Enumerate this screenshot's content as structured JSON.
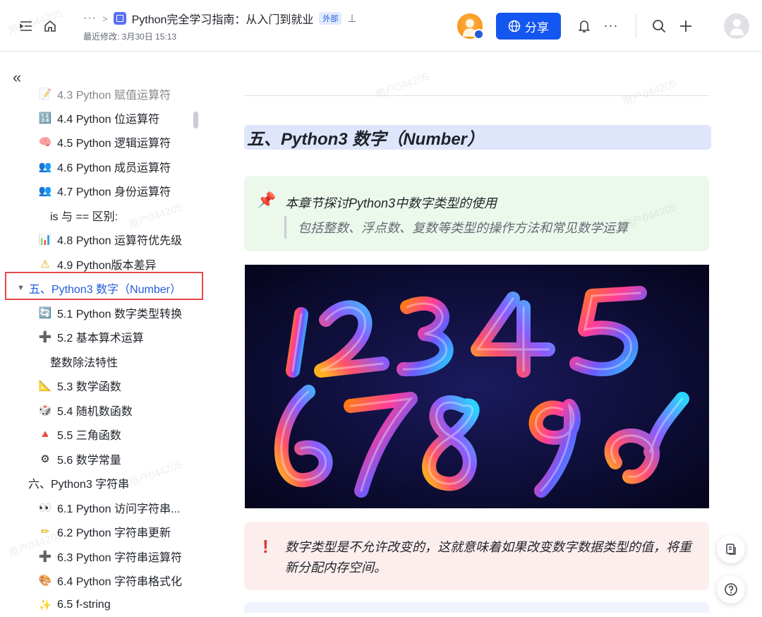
{
  "header": {
    "doc_title": "Python完全学习指南：从入门到就业",
    "external_badge": "外部",
    "last_modified": "最近修改: 3月30日 15:13",
    "more_label": "···",
    "share_label": "分享",
    "colors": {
      "share": "#1456f0",
      "accent": "#245bdb"
    }
  },
  "sidebar": {
    "items": [
      {
        "icon": "memo-icon",
        "glyph": "📝",
        "label": "4.3 Python 赋值运算符"
      },
      {
        "icon": "binary-icon",
        "glyph": "🔢",
        "label": "4.4 Python 位运算符"
      },
      {
        "icon": "brain-icon",
        "glyph": "🧠",
        "label": "4.5 Python 逻辑运算符"
      },
      {
        "icon": "people-icon",
        "glyph": "👥",
        "label": "4.6 Python 成员运算符"
      },
      {
        "icon": "people-icon",
        "glyph": "👥",
        "label": "4.7 Python 身份运算符"
      },
      {
        "icon": "",
        "glyph": "",
        "label": "is 与 == 区别:"
      },
      {
        "icon": "bar-chart-icon",
        "glyph": "📊",
        "label": "4.8 Python 运算符优先级"
      },
      {
        "icon": "warning-icon",
        "glyph": "⚠",
        "label": "4.9 Python版本差异"
      },
      {
        "icon": "",
        "glyph": "",
        "label": "五、Python3 数字（Number）"
      },
      {
        "icon": "sync-icon",
        "glyph": "🔄",
        "label": "5.1 Python 数字类型转换"
      },
      {
        "icon": "plus-icon",
        "glyph": "➕",
        "label": "5.2 基本算术运算"
      },
      {
        "icon": "",
        "glyph": "",
        "label": "整数除法特性"
      },
      {
        "icon": "ruler-triangle-icon",
        "glyph": "📐",
        "label": "5.3 数学函数"
      },
      {
        "icon": "dice-icon",
        "glyph": "🎲",
        "label": "5.4 随机数函数"
      },
      {
        "icon": "triangle-icon",
        "glyph": "🔺",
        "label": "5.5 三角函数"
      },
      {
        "icon": "gear-icon",
        "glyph": "⚙",
        "label": "5.6 数学常量"
      },
      {
        "icon": "",
        "glyph": "",
        "label": "六、Python3 字符串"
      },
      {
        "icon": "eyes-icon",
        "glyph": "👀",
        "label": "6.1 Python 访问字符串..."
      },
      {
        "icon": "pencil-icon",
        "glyph": "✏",
        "label": "6.2 Python 字符串更新"
      },
      {
        "icon": "plus-icon",
        "glyph": "➕",
        "label": "6.3 Python 字符串运算符"
      },
      {
        "icon": "palette-icon",
        "glyph": "🎨",
        "label": "6.4 Python 字符串格式化"
      },
      {
        "icon": "sparkle-icon",
        "glyph": "✨",
        "label": "6.5 f-string"
      }
    ]
  },
  "content": {
    "heading": "五、Python3 数字（Number）",
    "intro_title": "本章节探讨Python3中数字类型的使用",
    "intro_quote": "包括整数、浮点数、复数等类型的操作方法和常见数学运算",
    "warning_text": "数字类型是不允许改变的，这就意味着如果改变数字数据类型的值，将重新分配内存空间。"
  },
  "watermark": "用户044205"
}
